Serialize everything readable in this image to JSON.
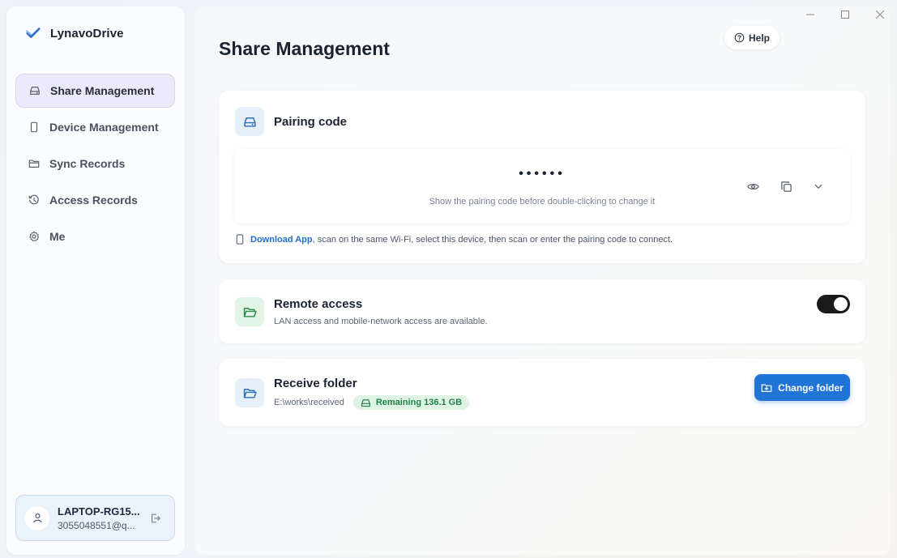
{
  "window": {
    "controls": [
      "minimize-icon",
      "maximize-icon",
      "close-icon"
    ]
  },
  "brand": {
    "name": "LynavoDrive",
    "icon": "check-logo-icon",
    "accent": "#2f6fd0"
  },
  "sidebar": {
    "items": [
      {
        "label": "Share Management",
        "icon": "drive-icon",
        "active": true
      },
      {
        "label": "Device Management",
        "icon": "phone-icon",
        "active": false
      },
      {
        "label": "Sync Records",
        "icon": "folder-icon",
        "active": false
      },
      {
        "label": "Access Records",
        "icon": "history-icon",
        "active": false
      },
      {
        "label": "Me",
        "icon": "gear-icon",
        "active": false
      }
    ]
  },
  "user": {
    "name": "LAPTOP-RG15...",
    "email": "3055048551@q...",
    "icon": "user-icon",
    "logout_icon": "logout-icon"
  },
  "header": {
    "title": "Share Management",
    "help_label": "Help",
    "help_icon": "question-circle-icon"
  },
  "pairing": {
    "title": "Pairing code",
    "icon": "drive-icon",
    "code_masked": "••••••",
    "hint": "Show the pairing code before double-clicking to change it",
    "actions": [
      "eye-icon",
      "copy-icon",
      "chevron-down-icon"
    ],
    "download_link": "Download App",
    "download_text": ", scan on the same Wi-Fi, select this device, then scan or enter the pairing code to connect."
  },
  "remote": {
    "title": "Remote access",
    "subtitle": "LAN access and mobile-network access are available.",
    "icon": "folder-open-icon",
    "enabled": true
  },
  "receive": {
    "title": "Receive folder",
    "path": "E:\\works\\received",
    "remaining": "Remaining 136.1 GB",
    "icon": "folder-open-icon",
    "button_label": "Change folder",
    "button_color": "#1f74d6"
  }
}
